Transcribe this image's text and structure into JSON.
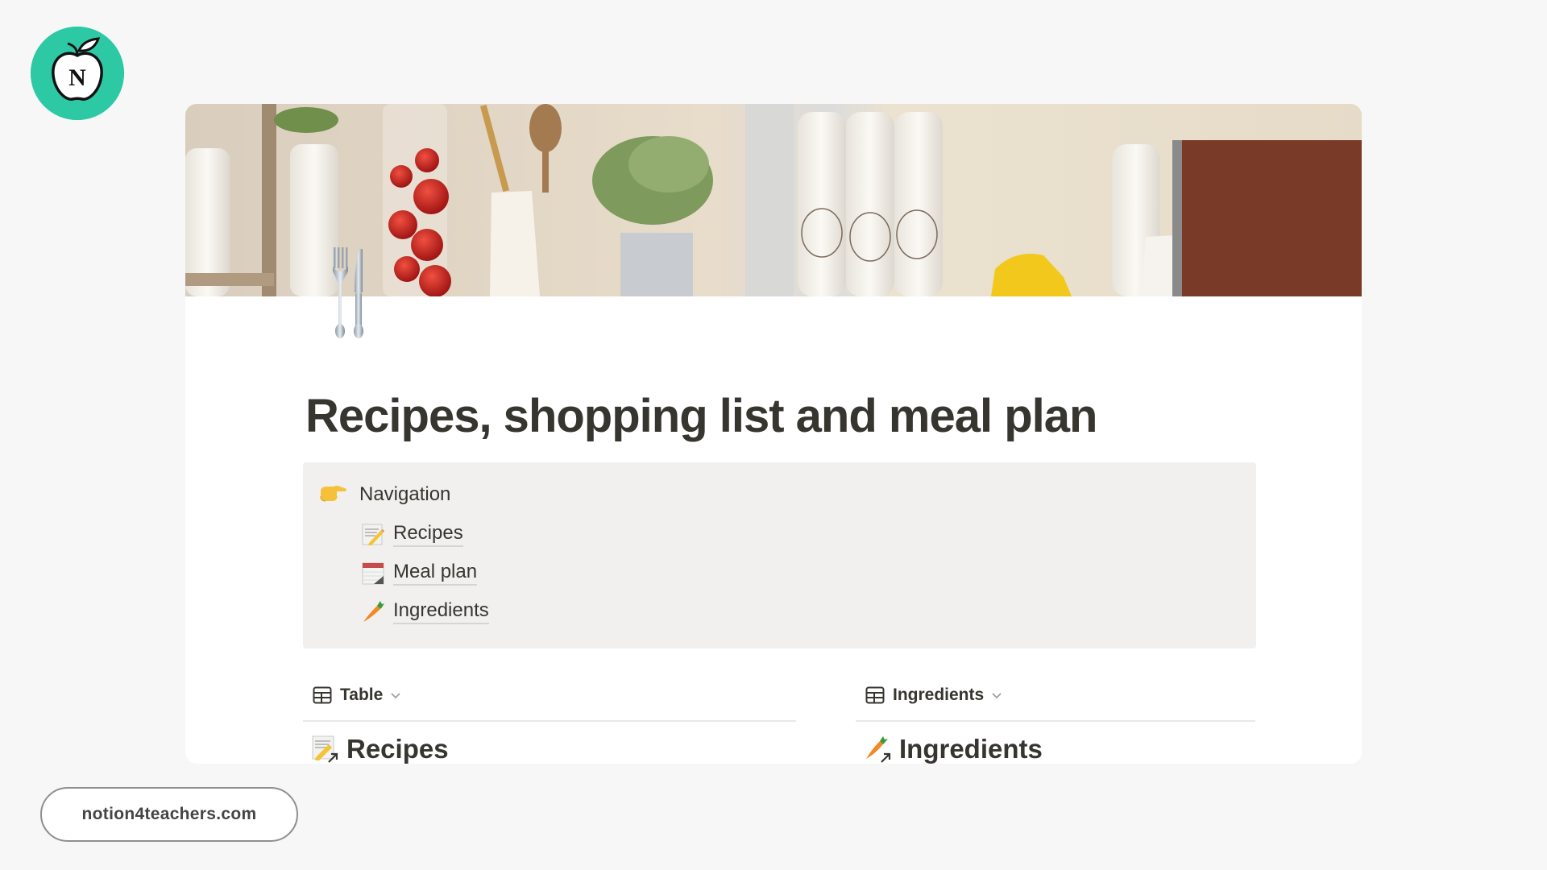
{
  "brand": {
    "logo_icon": "apple-n-logo-icon",
    "logo_letter": "N",
    "logo_color": "#2dc9a5",
    "website": "notion4teachers.com"
  },
  "page": {
    "cover_image": "kitchen-shelf-photo",
    "page_icon": "fork-and-knife-icon",
    "title": "Recipes, shopping list and meal plan",
    "title_color": "#37352f"
  },
  "callout": {
    "emoji": "backhand-index-pointing-left-icon",
    "heading": "Navigation",
    "background": "#f1f0ee",
    "items": [
      {
        "label": "Recipes",
        "icon": "memo-icon"
      },
      {
        "label": "Meal plan",
        "icon": "spiral-calendar-icon"
      },
      {
        "label": "Ingredients",
        "icon": "carrot-icon"
      }
    ]
  },
  "databases": [
    {
      "view_label": "Table",
      "view_icon": "table-icon",
      "title": "Recipes",
      "title_icon": "memo-link-icon"
    },
    {
      "view_label": "Ingredients",
      "view_icon": "table-icon",
      "title": "Ingredients",
      "title_icon": "carrot-link-icon"
    }
  ]
}
